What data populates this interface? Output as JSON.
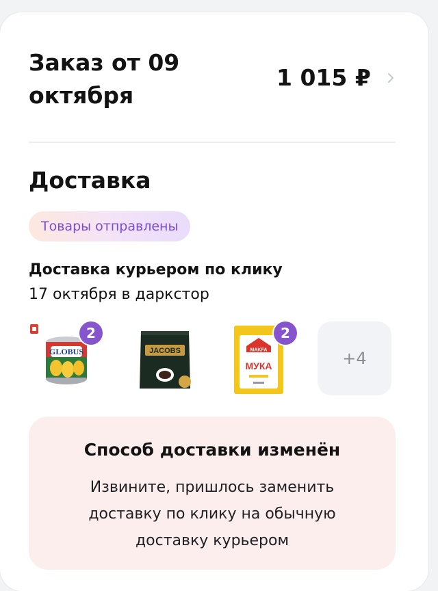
{
  "order": {
    "title": "Заказ от 09 октября",
    "price": "1 015 ₽"
  },
  "delivery": {
    "section_title": "Доставка",
    "status": "Товары отправлены",
    "method": "Доставка курьером по клику",
    "date": "17 октября в даркстор"
  },
  "products": [
    {
      "name": "GLOBUS",
      "quantity": "2",
      "icon": "corn-can-icon"
    },
    {
      "name": "JACOBS",
      "icon": "coffee-pack-icon"
    },
    {
      "name": "MAKFA",
      "subtitle": "МУКА",
      "quantity": "2",
      "icon": "flour-pack-icon"
    }
  ],
  "more_count": "+4",
  "notice": {
    "title": "Способ доставки изменён",
    "text": "Извините, пришлось заменить доставку по клику на обычную доставку курьером"
  },
  "colors": {
    "accent": "#8654cc",
    "status_text": "#7b4bd6",
    "notice_bg": "#fdeeee",
    "more_bg": "#f1f3f6"
  }
}
